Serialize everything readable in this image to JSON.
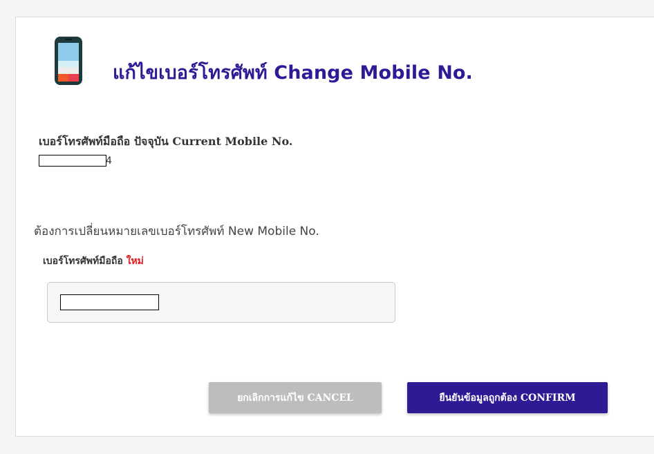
{
  "header": {
    "title": "แก้ไขเบอร์โทรศัพท์ Change Mobile No.",
    "icon": "mobile-phone-icon",
    "title_color": "#2d1b96"
  },
  "current": {
    "label": "เบอร์โทรศัพท์มือถือ ปัจจุบัน Current Mobile No.",
    "visible_suffix": "4"
  },
  "new_number": {
    "heading": "ต้องการเปลี่ยนหมายเลขเบอร์โทรศัพท์ New Mobile No.",
    "label": "เบอร์โทรศัพท์มือถือ",
    "label_accent": "ใหม่",
    "accent_color": "#e5161c"
  },
  "buttons": {
    "cancel_label": "ยกเลิกการแก้ไข CANCEL",
    "confirm_label": "ยืนยันข้อมูลถูกต้อง CONFIRM",
    "confirm_color": "#2d1b96",
    "cancel_color": "#bdbdbd"
  }
}
